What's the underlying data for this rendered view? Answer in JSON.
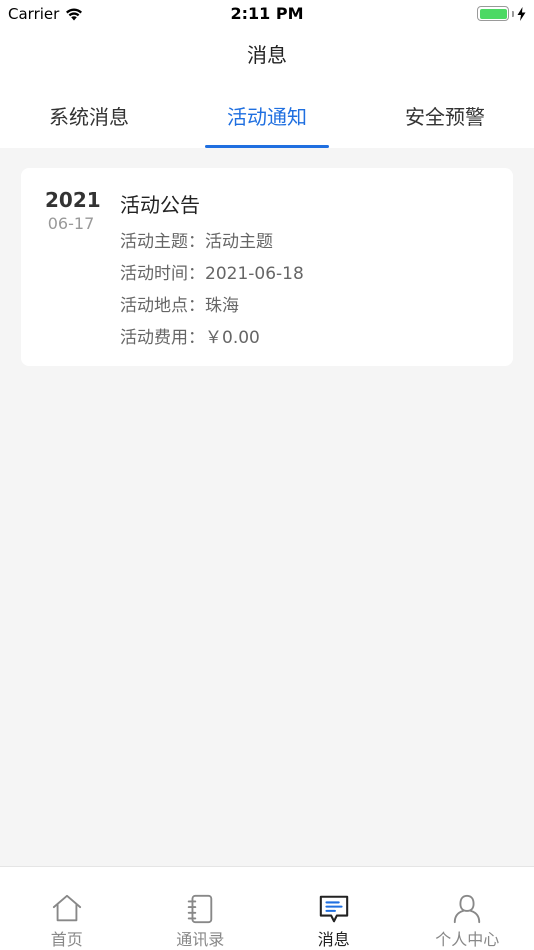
{
  "status_bar": {
    "carrier": "Carrier",
    "time": "2:11 PM"
  },
  "header": {
    "title": "消息"
  },
  "tabs": [
    {
      "label": "系统消息",
      "active": false
    },
    {
      "label": "活动通知",
      "active": true
    },
    {
      "label": "安全预警",
      "active": false
    }
  ],
  "notice": {
    "year": "2021",
    "month_day": "06-17",
    "title": "活动公告",
    "lines": [
      "活动主题：活动主题",
      "活动时间：2021-06-18",
      "活动地点：珠海",
      "活动费用：￥0.00"
    ]
  },
  "tabbar": [
    {
      "label": "首页",
      "icon": "home-icon"
    },
    {
      "label": "通讯录",
      "icon": "contacts-icon"
    },
    {
      "label": "消息",
      "icon": "message-icon",
      "active": true
    },
    {
      "label": "个人中心",
      "icon": "person-icon"
    }
  ],
  "colors": {
    "accent": "#1f6fe0",
    "battery": "#4cd964",
    "background": "#f5f5f5"
  }
}
